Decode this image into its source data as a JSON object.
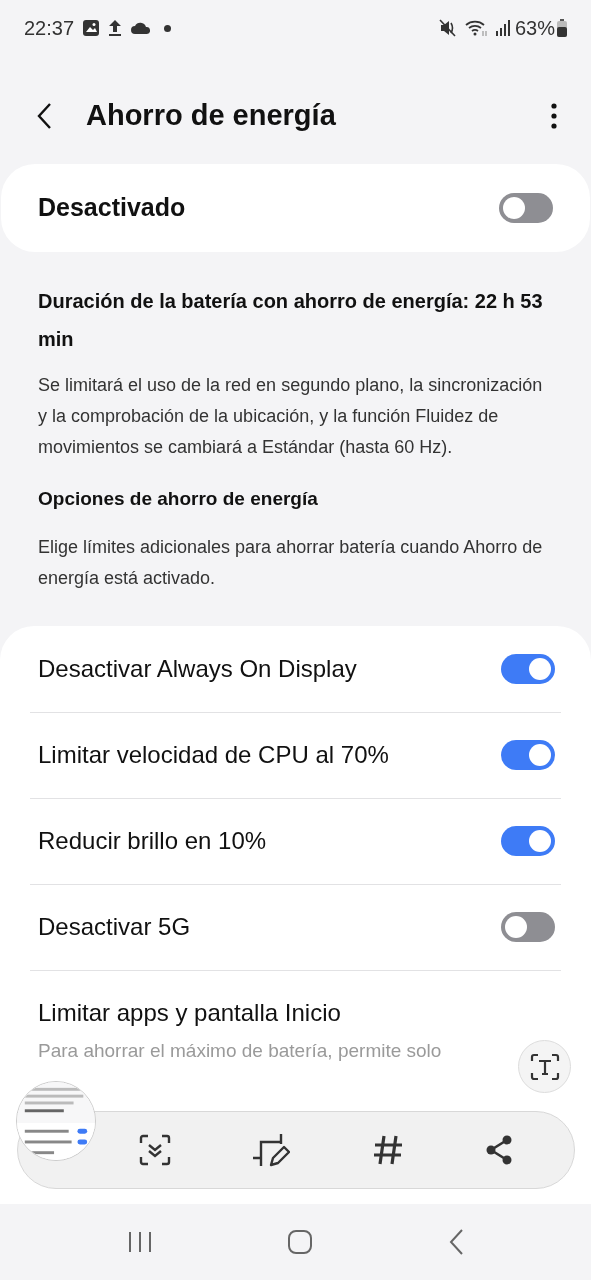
{
  "status_bar": {
    "time": "22:37",
    "battery": "63%"
  },
  "header": {
    "title": "Ahorro de energía"
  },
  "master": {
    "label": "Desactivado",
    "on": false
  },
  "info": {
    "title": "Duración de la batería con ahorro de energía: 22 h 53 min",
    "text": "Se limitará el uso de la red en segundo plano, la sincronización y la comprobación de la ubicación, y la función Fluidez de movimientos se cambiará a Estándar (hasta 60 Hz)."
  },
  "options": {
    "title": "Opciones de ahorro de energía",
    "text": "Elige límites adicionales para ahorrar batería cuando Ahorro de energía está activado."
  },
  "settings": [
    {
      "kind": "switch",
      "label": "Desactivar Always On Display",
      "on": true
    },
    {
      "kind": "switch",
      "label": "Limitar velocidad de CPU al 70%",
      "on": true
    },
    {
      "kind": "switch",
      "label": "Reducir brillo en 10%",
      "on": true
    },
    {
      "kind": "switch",
      "label": "Desactivar 5G",
      "on": false
    },
    {
      "kind": "link",
      "label": "Limitar apps y pantalla Inicio",
      "subtitle": "Para ahorrar el máximo de batería, permite solo"
    }
  ]
}
